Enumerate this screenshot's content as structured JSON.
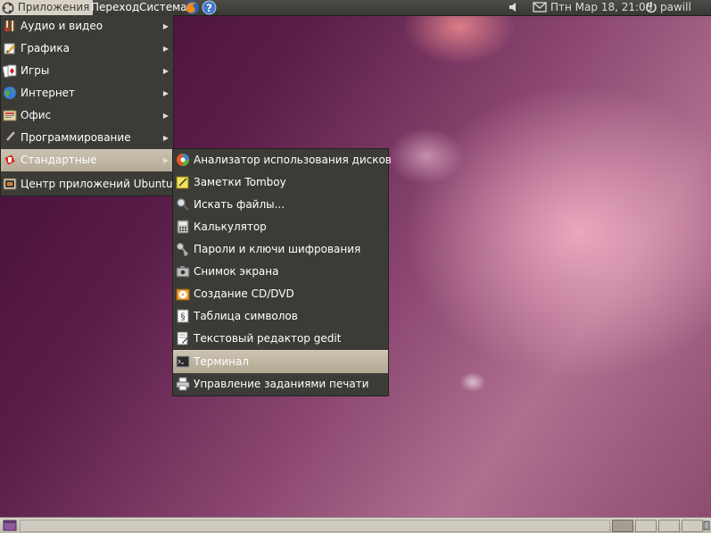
{
  "top_panel": {
    "menus": {
      "applications": "Приложения",
      "places": "Переход",
      "system": "Система"
    },
    "clock": "Птн Мар 18, 21:08",
    "user": "pawill",
    "icons": [
      "ubuntu-logo-icon",
      "firefox-icon",
      "help-icon",
      "volume-icon",
      "mail-icon",
      "power-icon"
    ]
  },
  "applications_menu": {
    "items": [
      {
        "label": "Аудио и видео",
        "icon": "audio-video-icon",
        "submenu": true
      },
      {
        "label": "Графика",
        "icon": "graphics-icon",
        "submenu": true
      },
      {
        "label": "Игры",
        "icon": "games-icon",
        "submenu": true
      },
      {
        "label": "Интернет",
        "icon": "internet-icon",
        "submenu": true
      },
      {
        "label": "Офис",
        "icon": "office-icon",
        "submenu": true
      },
      {
        "label": "Программирование",
        "icon": "programming-icon",
        "submenu": true
      },
      {
        "label": "Стандартные",
        "icon": "accessories-icon",
        "submenu": true,
        "selected": true
      },
      {
        "label": "Центр приложений Ubuntu",
        "icon": "software-center-icon",
        "submenu": false
      }
    ]
  },
  "accessories_menu": {
    "items": [
      {
        "label": "Анализатор использования дисков",
        "icon": "disk-usage-icon"
      },
      {
        "label": "Заметки Tomboy",
        "icon": "tomboy-notes-icon"
      },
      {
        "label": "Искать файлы...",
        "icon": "search-icon"
      },
      {
        "label": "Калькулятор",
        "icon": "calculator-icon"
      },
      {
        "label": "Пароли и ключи шифрования",
        "icon": "keys-icon"
      },
      {
        "label": "Снимок экрана",
        "icon": "camera-icon"
      },
      {
        "label": "Создание CD/DVD",
        "icon": "cd-dvd-icon"
      },
      {
        "label": "Таблица символов",
        "icon": "char-map-icon"
      },
      {
        "label": "Текстовый редактор gedit",
        "icon": "text-editor-icon"
      },
      {
        "label": "Терминал",
        "icon": "terminal-icon",
        "selected": true
      },
      {
        "label": "Управление заданиями печати",
        "icon": "printer-icon"
      }
    ]
  },
  "colors": {
    "panel": "#3c3b37",
    "menu_bg": "#3c3b37",
    "highlight": "#c6bcaa",
    "desktop_accent": "#8a4670"
  }
}
